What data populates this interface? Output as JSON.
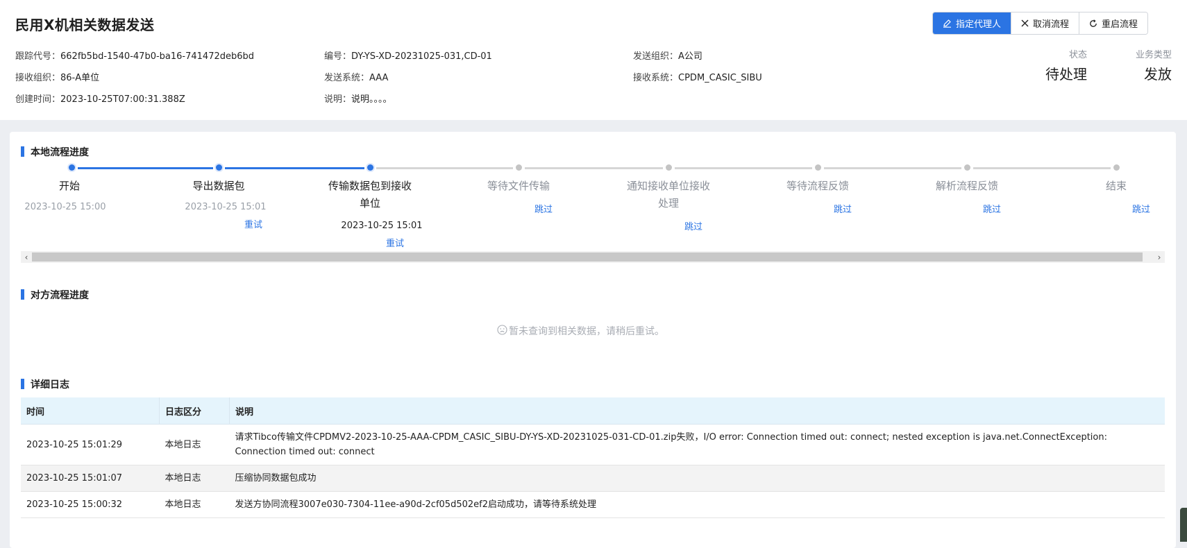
{
  "header": {
    "title": "民用X机相关数据发送",
    "actions": {
      "assign_label": "指定代理人",
      "cancel_label": "取消流程",
      "restart_label": "重启流程"
    },
    "meta": {
      "tracking_label": "跟踪代号：",
      "tracking_value": "662fb5bd-1540-47b0-ba16-741472deb6bd",
      "number_label": "编号：",
      "number_value": "DY-YS-XD-20231025-031,CD-01",
      "send_org_label": "发送组织：",
      "send_org_value": "A公司",
      "recv_org_label": "接收组织：",
      "recv_org_value": "86-A单位",
      "send_sys_label": "发送系统：",
      "send_sys_value": "AAA",
      "recv_sys_label": "接收系统：",
      "recv_sys_value": "CPDM_CASIC_SIBU",
      "created_label": "创建时间：",
      "created_value": "2023-10-25T07:00:31.388Z",
      "desc_label": "说明：",
      "desc_value": "说明。。。。"
    },
    "status": {
      "label": "状态",
      "value": "待处理"
    },
    "biz_type": {
      "label": "业务类型",
      "value": "发放"
    }
  },
  "local_progress": {
    "title": "本地流程进度",
    "accent": "#2b74e3",
    "steps": [
      {
        "title": "开始",
        "time": "2023-10-25 15:00",
        "link": "",
        "state": "done"
      },
      {
        "title": "导出数据包",
        "time": "2023-10-25 15:01",
        "link": "重试",
        "state": "done"
      },
      {
        "title_line1": "传输数据包到接收",
        "title_line2": "单位",
        "time": "2023-10-25 15:01",
        "link": "重试",
        "state": "current"
      },
      {
        "title": "等待文件传输",
        "time": "",
        "link": "跳过",
        "state": "pending"
      },
      {
        "title_line1": "通知接收单位接收",
        "title_line2": "处理",
        "time": "",
        "link": "跳过",
        "state": "pending"
      },
      {
        "title": "等待流程反馈",
        "time": "",
        "link": "跳过",
        "state": "pending"
      },
      {
        "title": "解析流程反馈",
        "time": "",
        "link": "跳过",
        "state": "pending"
      },
      {
        "title": "结束",
        "time": "",
        "link": "跳过",
        "state": "pending"
      }
    ]
  },
  "remote_progress": {
    "title": "对方流程进度",
    "empty_text": "暂未查询到相关数据，请稍后重试。"
  },
  "log": {
    "title": "详细日志",
    "columns": [
      "时间",
      "日志区分",
      "说明"
    ],
    "rows": [
      {
        "time": "2023-10-25 15:01:29",
        "kind": "本地日志",
        "desc": "请求Tibco传输文件CPDMV2-2023-10-25-AAA-CPDM_CASIC_SIBU-DY-YS-XD-20231025-031-CD-01.zip失败，I/O error: Connection timed out: connect; nested exception is java.net.ConnectException: Connection timed out: connect"
      },
      {
        "time": "2023-10-25 15:01:07",
        "kind": "本地日志",
        "desc": "压缩协同数据包成功"
      },
      {
        "time": "2023-10-25 15:00:32",
        "kind": "本地日志",
        "desc": "发送方协同流程3007e030-7304-11ee-a90d-2cf05d502ef2启动成功，请等待系统处理"
      }
    ]
  }
}
